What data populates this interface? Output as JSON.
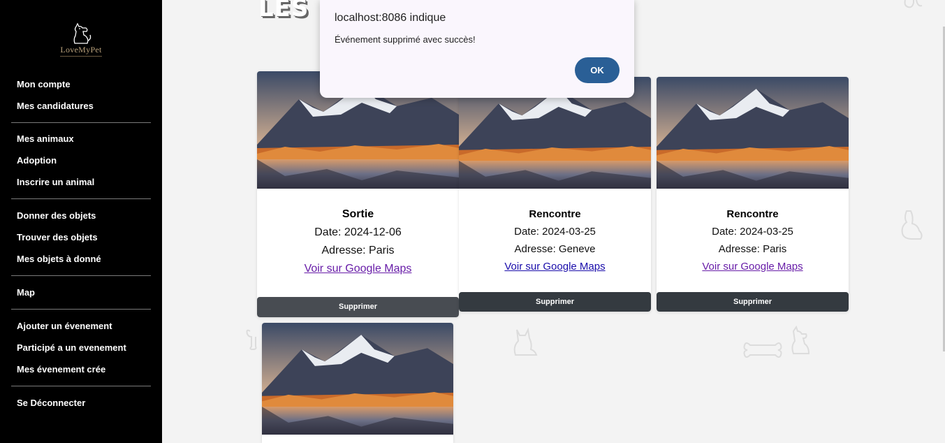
{
  "sidebar": {
    "logo_text": "LoveMyPet",
    "groups": [
      [
        {
          "label": "Mon compte"
        },
        {
          "label": "Mes candidatures"
        }
      ],
      [
        {
          "label": "Mes animaux"
        },
        {
          "label": "Adoption"
        },
        {
          "label": "Inscrire un animal"
        }
      ],
      [
        {
          "label": "Donner des objets"
        },
        {
          "label": "Trouver des objets"
        },
        {
          "label": "Mes objets à donné"
        }
      ],
      [
        {
          "label": "Map"
        }
      ],
      [
        {
          "label": "Ajouter un évenement"
        },
        {
          "label": "Participé a un evenement"
        },
        {
          "label": "Mes évenement crée"
        }
      ],
      [
        {
          "label": "Se Déconnecter"
        }
      ]
    ]
  },
  "page": {
    "title": "LES ÉVÉNEMENTS CRÉÉS"
  },
  "events": [
    {
      "title": "Sortie",
      "date": "Date: 2024-12-06",
      "address": "Adresse: Paris",
      "maps_label": "Voir sur Google Maps",
      "delete_label": "Supprimer"
    },
    {
      "title": "Rencontre",
      "date": "Date: 2024-03-25",
      "address": "Adresse: Geneve",
      "maps_label": "Voir sur Google Maps",
      "delete_label": "Supprimer"
    },
    {
      "title": "Rencontre",
      "date": "Date: 2024-03-25",
      "address": "Adresse: Paris",
      "maps_label": "Voir sur Google Maps",
      "delete_label": "Supprimer"
    }
  ],
  "dialog": {
    "title": "localhost:8086 indique",
    "message": "Événement supprimé avec succès!",
    "ok_label": "OK"
  },
  "colors": {
    "sidebar_bg": "#000000",
    "page_bg": "#f3f3f3",
    "button_dark": "#343a40",
    "dialog_ok": "#2a5f96",
    "link": "#1a0dab",
    "link_visited": "#681da8"
  }
}
